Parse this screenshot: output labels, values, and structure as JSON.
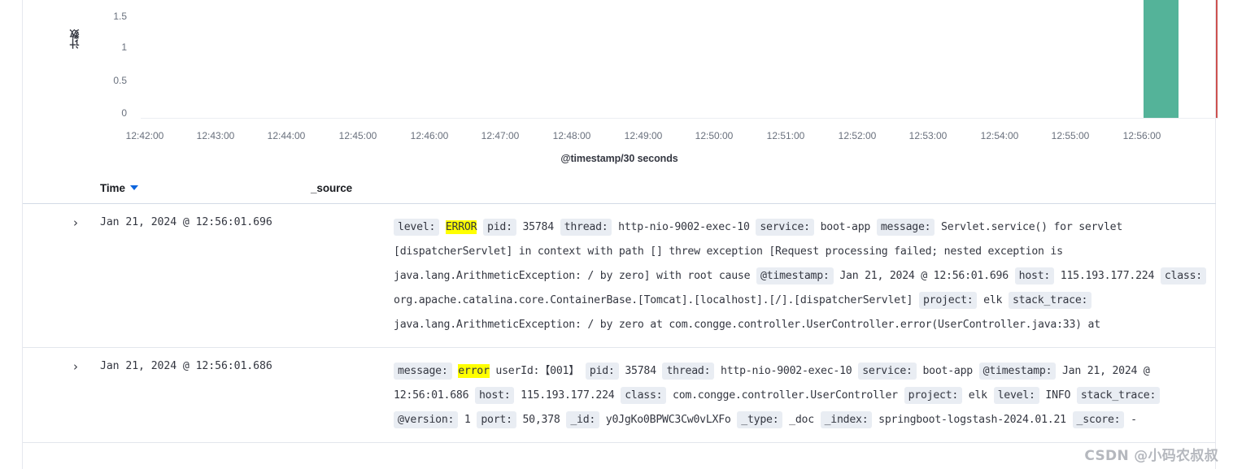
{
  "histogram": {
    "y_axis_title": "计数",
    "x_axis_title": "@timestamp/30 seconds",
    "y_ticks": [
      "1.5",
      "1",
      "0.5",
      "0"
    ],
    "x_ticks": [
      "12:42:00",
      "12:43:00",
      "12:44:00",
      "12:45:00",
      "12:46:00",
      "12:47:00",
      "12:48:00",
      "12:49:00",
      "12:50:00",
      "12:51:00",
      "12:52:00",
      "12:53:00",
      "12:54:00",
      "12:55:00",
      "12:56:00"
    ],
    "bar_color": "#54b399",
    "marker_color": "#cc5150"
  },
  "chart_data": {
    "type": "bar",
    "title": "",
    "xlabel": "@timestamp/30 seconds",
    "ylabel": "计数",
    "categories": [
      "12:42:00",
      "12:42:30",
      "12:43:00",
      "12:43:30",
      "12:44:00",
      "12:44:30",
      "12:45:00",
      "12:45:30",
      "12:46:00",
      "12:46:30",
      "12:47:00",
      "12:47:30",
      "12:48:00",
      "12:48:30",
      "12:49:00",
      "12:49:30",
      "12:50:00",
      "12:50:30",
      "12:51:00",
      "12:51:30",
      "12:52:00",
      "12:52:30",
      "12:53:00",
      "12:53:30",
      "12:54:00",
      "12:54:30",
      "12:55:00",
      "12:55:30",
      "12:56:00"
    ],
    "values": [
      0,
      0,
      0,
      0,
      0,
      0,
      0,
      0,
      0,
      0,
      0,
      0,
      0,
      0,
      0,
      0,
      0,
      0,
      0,
      0,
      0,
      0,
      0,
      0,
      0,
      0,
      0,
      0,
      2
    ],
    "ylim": [
      0,
      1.7
    ],
    "yticks": [
      0,
      0.5,
      1,
      1.5
    ],
    "grid": false,
    "legend": "none",
    "series": [
      {
        "name": "Count",
        "values": [
          0,
          0,
          0,
          0,
          0,
          0,
          0,
          0,
          0,
          0,
          0,
          0,
          0,
          0,
          0,
          0,
          0,
          0,
          0,
          0,
          0,
          0,
          0,
          0,
          0,
          0,
          0,
          0,
          2
        ],
        "color": "#54b399"
      }
    ],
    "annotations": [
      {
        "type": "vertical-line",
        "x": "12:56:30",
        "color": "#cc5150",
        "label": ""
      }
    ]
  },
  "table": {
    "columns": [
      {
        "label": "Time",
        "sort": "desc"
      },
      {
        "label": "_source"
      }
    ],
    "rows": [
      {
        "time": "Jan 21, 2024 @ 12:56:01.696",
        "fields": [
          {
            "key": "level:",
            "value": "ERROR",
            "highlight": true
          },
          {
            "key": "pid:",
            "value": "35784"
          },
          {
            "key": "thread:",
            "value": "http-nio-9002-exec-10"
          },
          {
            "key": "service:",
            "value": "boot-app"
          },
          {
            "key": "message:",
            "value": "Servlet.service() for servlet [dispatcherServlet] in context with path [] threw exception [Request processing failed; nested exception is java.lang.ArithmeticException: / by zero] with root cause"
          },
          {
            "key": "@timestamp:",
            "value": "Jan 21, 2024 @ 12:56:01.696"
          },
          {
            "key": "host:",
            "value": "115.193.177.224"
          },
          {
            "key": "class:",
            "value": "org.apache.catalina.core.ContainerBase.[Tomcat].[localhost].[/].[dispatcherServlet]"
          },
          {
            "key": "project:",
            "value": "elk"
          },
          {
            "key": "stack_trace:",
            "value": "java.lang.ArithmeticException: / by zero at com.congge.controller.UserController.error(UserController.java:33) at"
          }
        ]
      },
      {
        "time": "Jan 21, 2024 @ 12:56:01.686",
        "fields": [
          {
            "key": "message:",
            "value": "error userId:【001】",
            "highlight": true,
            "highlight_text": "error",
            "rest_text": " userId:【001】"
          },
          {
            "key": "pid:",
            "value": "35784"
          },
          {
            "key": "thread:",
            "value": "http-nio-9002-exec-10"
          },
          {
            "key": "service:",
            "value": "boot-app"
          },
          {
            "key": "@timestamp:",
            "value": "Jan 21, 2024 @ 12:56:01.686"
          },
          {
            "key": "host:",
            "value": "115.193.177.224"
          },
          {
            "key": "class:",
            "value": "com.congge.controller.UserController"
          },
          {
            "key": "project:",
            "value": "elk"
          },
          {
            "key": "level:",
            "value": "INFO"
          },
          {
            "key": "stack_trace:",
            "value": ""
          },
          {
            "key": "@version:",
            "value": "1"
          },
          {
            "key": "port:",
            "value": "50,378"
          },
          {
            "key": "_id:",
            "value": "y0JgKo0BPWC3Cw0vLXFo"
          },
          {
            "key": "_type:",
            "value": "_doc"
          },
          {
            "key": "_index:",
            "value": "springboot-logstash-2024.01.21"
          },
          {
            "key": "_score:",
            "value": "-"
          }
        ]
      }
    ],
    "expand_icon": "chevron-right"
  },
  "watermark": "CSDN @小码农叔叔"
}
